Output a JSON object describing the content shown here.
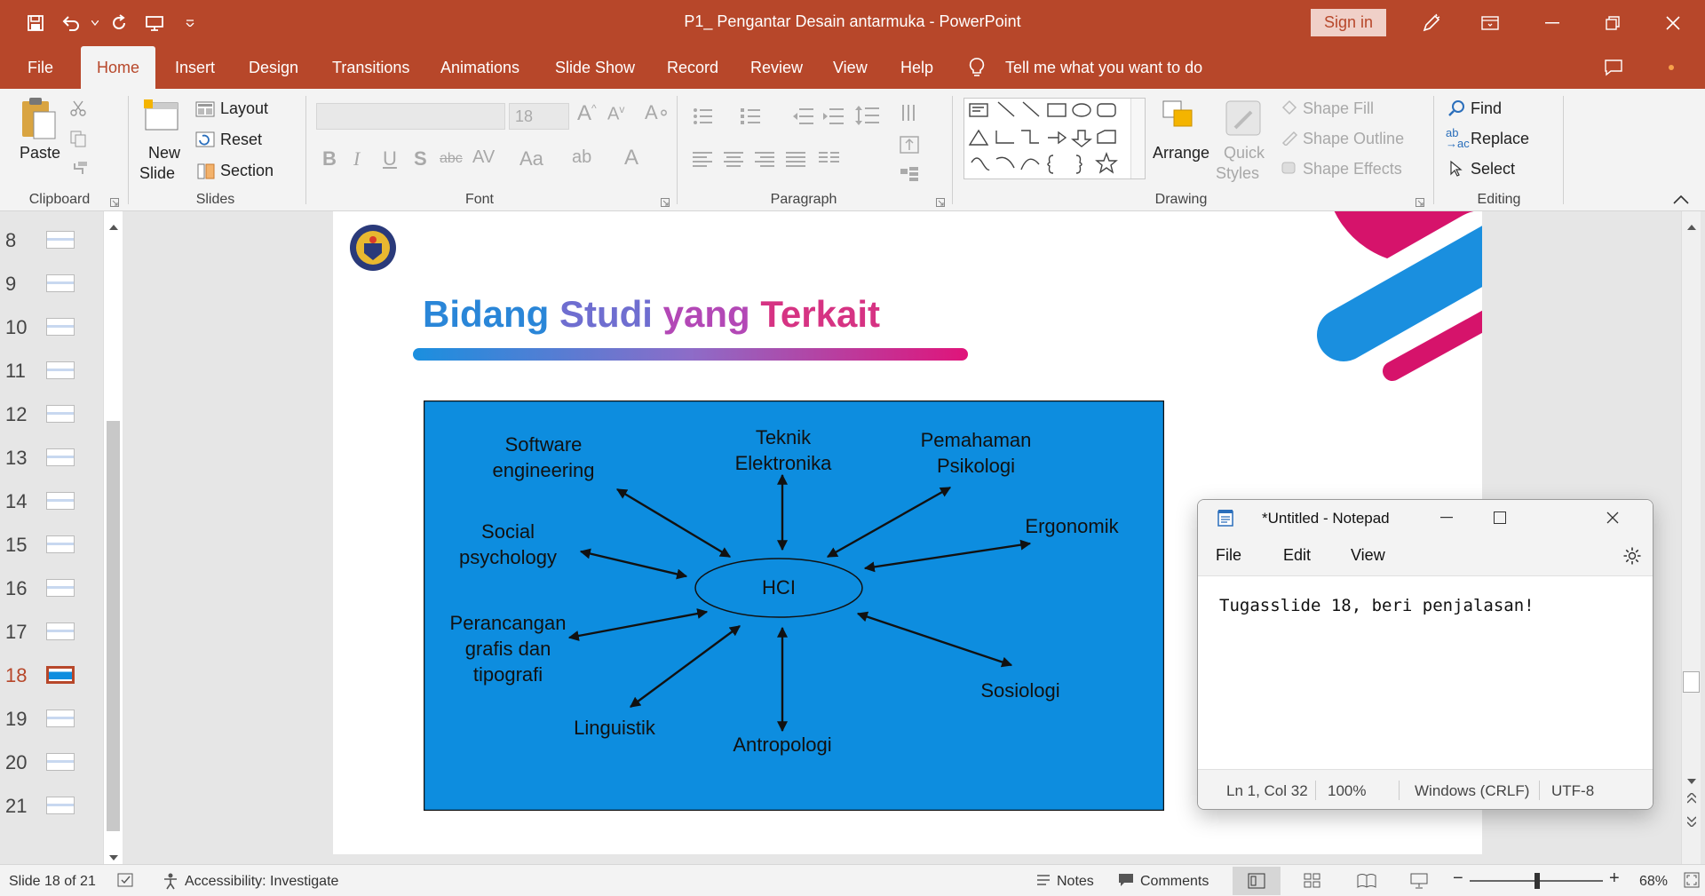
{
  "app": {
    "title": "P1_ Pengantar Desain antarmuka  -  PowerPoint",
    "sign_in": "Sign in",
    "accent_color": "#b7472a"
  },
  "tabs": [
    "File",
    "Home",
    "Insert",
    "Design",
    "Transitions",
    "Animations",
    "Slide Show",
    "Record",
    "Review",
    "View",
    "Help"
  ],
  "tell_me": "Tell me what you want to do",
  "ribbon": {
    "clipboard": {
      "paste": "Paste",
      "group": "Clipboard"
    },
    "slides": {
      "new_slide_1": "New",
      "new_slide_2": "Slide",
      "layout": "Layout",
      "reset": "Reset",
      "section": "Section",
      "group": "Slides"
    },
    "font": {
      "size": "18",
      "group": "Font"
    },
    "paragraph": {
      "group": "Paragraph"
    },
    "drawing": {
      "arrange": "Arrange",
      "quick_1": "Quick",
      "quick_2": "Styles",
      "shape_fill": "Shape Fill",
      "shape_outline": "Shape Outline",
      "shape_effects": "Shape Effects",
      "group": "Drawing"
    },
    "editing": {
      "find": "Find",
      "replace": "Replace",
      "select": "Select",
      "group": "Editing"
    }
  },
  "thumbnails": [
    {
      "num": "8"
    },
    {
      "num": "9"
    },
    {
      "num": "10"
    },
    {
      "num": "11"
    },
    {
      "num": "12"
    },
    {
      "num": "13"
    },
    {
      "num": "14"
    },
    {
      "num": "15"
    },
    {
      "num": "16"
    },
    {
      "num": "17"
    },
    {
      "num": "18",
      "active": true
    },
    {
      "num": "19"
    },
    {
      "num": "20"
    },
    {
      "num": "21"
    }
  ],
  "slide": {
    "title_words": [
      "Bidang",
      "Studi",
      "yang",
      "Terkait"
    ],
    "title_colors": [
      "#2a86d8",
      "#6f6ed0",
      "#b348b6",
      "#d63383"
    ],
    "diagram": {
      "bg_color": "#0d8ddf",
      "center": "HCI",
      "nodes": {
        "software": [
          "Software",
          "engineering"
        ],
        "teknik": [
          "Teknik",
          "Elektronika"
        ],
        "pemahaman": [
          "Pemahaman",
          "Psikologi"
        ],
        "ergonomik": [
          "Ergonomik"
        ],
        "social": [
          "Social",
          "psychology"
        ],
        "perancangan": [
          "Perancangan",
          "grafis dan",
          "tipografi"
        ],
        "linguistik": [
          "Linguistik"
        ],
        "antropologi": [
          "Antropologi"
        ],
        "sosiologi": [
          "Sosiologi"
        ]
      }
    }
  },
  "notepad": {
    "title": "*Untitled - Notepad",
    "menu": [
      "File",
      "Edit",
      "View"
    ],
    "text": "Tugasslide 18, beri penjalasan!",
    "status": {
      "pos": "Ln 1, Col 32",
      "zoom": "100%",
      "eol": "Windows (CRLF)",
      "encoding": "UTF-8"
    }
  },
  "statusbar": {
    "slide_info": "Slide 18 of 21",
    "accessibility": "Accessibility: Investigate",
    "notes": "Notes",
    "comments": "Comments",
    "zoom": "68%",
    "zoom_level_fraction": 0.68
  }
}
